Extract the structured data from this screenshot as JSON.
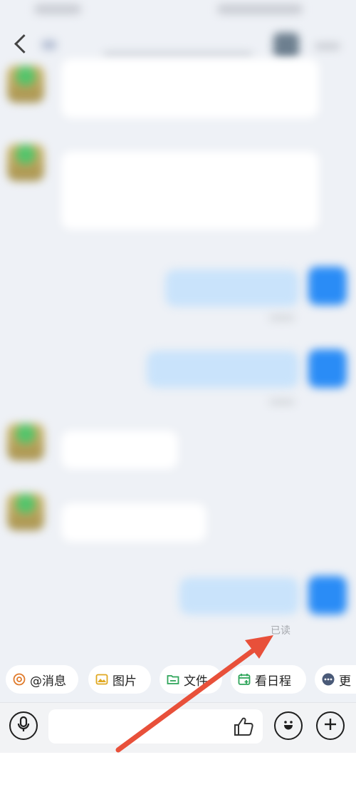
{
  "status_bar": {
    "time": "",
    "indicators": ""
  },
  "nav": {
    "title": "",
    "subtitle": ""
  },
  "messages": [
    {
      "side": "left",
      "text": "",
      "avatar": "bubble-tea-avatar"
    },
    {
      "side": "left",
      "text": "",
      "avatar": "bubble-tea-avatar"
    },
    {
      "side": "right",
      "text": "",
      "avatar_text": ""
    },
    {
      "side": "right",
      "text": "",
      "avatar_text": ""
    },
    {
      "side": "left",
      "text": "",
      "avatar": "bubble-tea-avatar"
    },
    {
      "side": "left",
      "text": "",
      "avatar": "bubble-tea-avatar"
    },
    {
      "side": "right",
      "text": "",
      "avatar_text": ""
    }
  ],
  "read_status": "已读",
  "shortcuts": [
    {
      "label": "@消息",
      "icon": "at-icon",
      "color": "#e07b2c"
    },
    {
      "label": "图片",
      "icon": "image-icon",
      "color": "#e0a820"
    },
    {
      "label": "文件",
      "icon": "folder-icon",
      "color": "#2fa55a"
    },
    {
      "label": "看日程",
      "icon": "calendar-icon",
      "color": "#2fa55a"
    },
    {
      "label": "更",
      "icon": "more-icon",
      "color": "#4a5a78"
    }
  ],
  "composer": {
    "placeholder": ""
  },
  "colors": {
    "self_bubble": "#c9e3fb",
    "self_avatar": "#2a8cf6",
    "annotation_arrow": "#e8503a"
  }
}
